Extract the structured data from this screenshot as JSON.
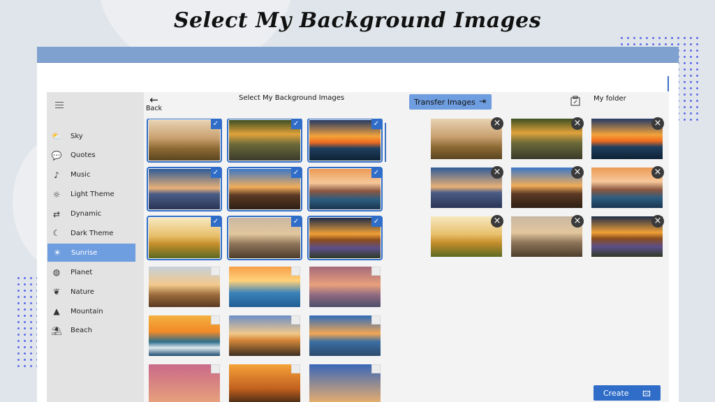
{
  "hero": {
    "title": "Select My Background Images"
  },
  "sidebar": {
    "items": [
      {
        "label": "Sky",
        "icon": "cloud-sun-icon"
      },
      {
        "label": "Quotes",
        "icon": "chat-icon"
      },
      {
        "label": "Music",
        "icon": "music-note-icon"
      },
      {
        "label": "Light Theme",
        "icon": "sun-icon"
      },
      {
        "label": "Dynamic",
        "icon": "dynamic-icon"
      },
      {
        "label": "Dark Theme",
        "icon": "moon-icon"
      },
      {
        "label": "Sunrise",
        "icon": "sunrise-icon",
        "active": true
      },
      {
        "label": "Planet",
        "icon": "planet-icon"
      },
      {
        "label": "Nature",
        "icon": "leaf-icon"
      },
      {
        "label": "Mountain",
        "icon": "mountain-icon"
      },
      {
        "label": "Beach",
        "icon": "beach-icon"
      }
    ]
  },
  "header": {
    "back_label": "Back",
    "title": "Select My Background Images",
    "transfer_label": "Transfer Images",
    "folder_title": "My  folder"
  },
  "create_label": "Create",
  "grid": {
    "thumbnails": [
      {
        "scene": "g1",
        "selected": true
      },
      {
        "scene": "g2",
        "selected": true
      },
      {
        "scene": "g3",
        "selected": true
      },
      {
        "scene": "g4",
        "selected": true
      },
      {
        "scene": "g5",
        "selected": true
      },
      {
        "scene": "g6",
        "selected": true
      },
      {
        "scene": "g7",
        "selected": true
      },
      {
        "scene": "g8",
        "selected": true
      },
      {
        "scene": "g9",
        "selected": true
      },
      {
        "scene": "g10",
        "selected": false
      },
      {
        "scene": "g11",
        "selected": false
      },
      {
        "scene": "g12",
        "selected": false
      },
      {
        "scene": "g13",
        "selected": false
      },
      {
        "scene": "g14",
        "selected": false
      },
      {
        "scene": "g15",
        "selected": false
      },
      {
        "scene": "g16",
        "selected": false
      },
      {
        "scene": "g17",
        "selected": false
      },
      {
        "scene": "g18",
        "selected": false
      }
    ]
  },
  "folder": {
    "thumbnails": [
      "g1",
      "g2",
      "g3",
      "g4",
      "g5",
      "g6",
      "g7",
      "g8",
      "g9"
    ]
  },
  "colors": {
    "accent": "#2f6dc8",
    "active_nav": "#6f9ee0",
    "titlebar": "#7fa1cf"
  }
}
